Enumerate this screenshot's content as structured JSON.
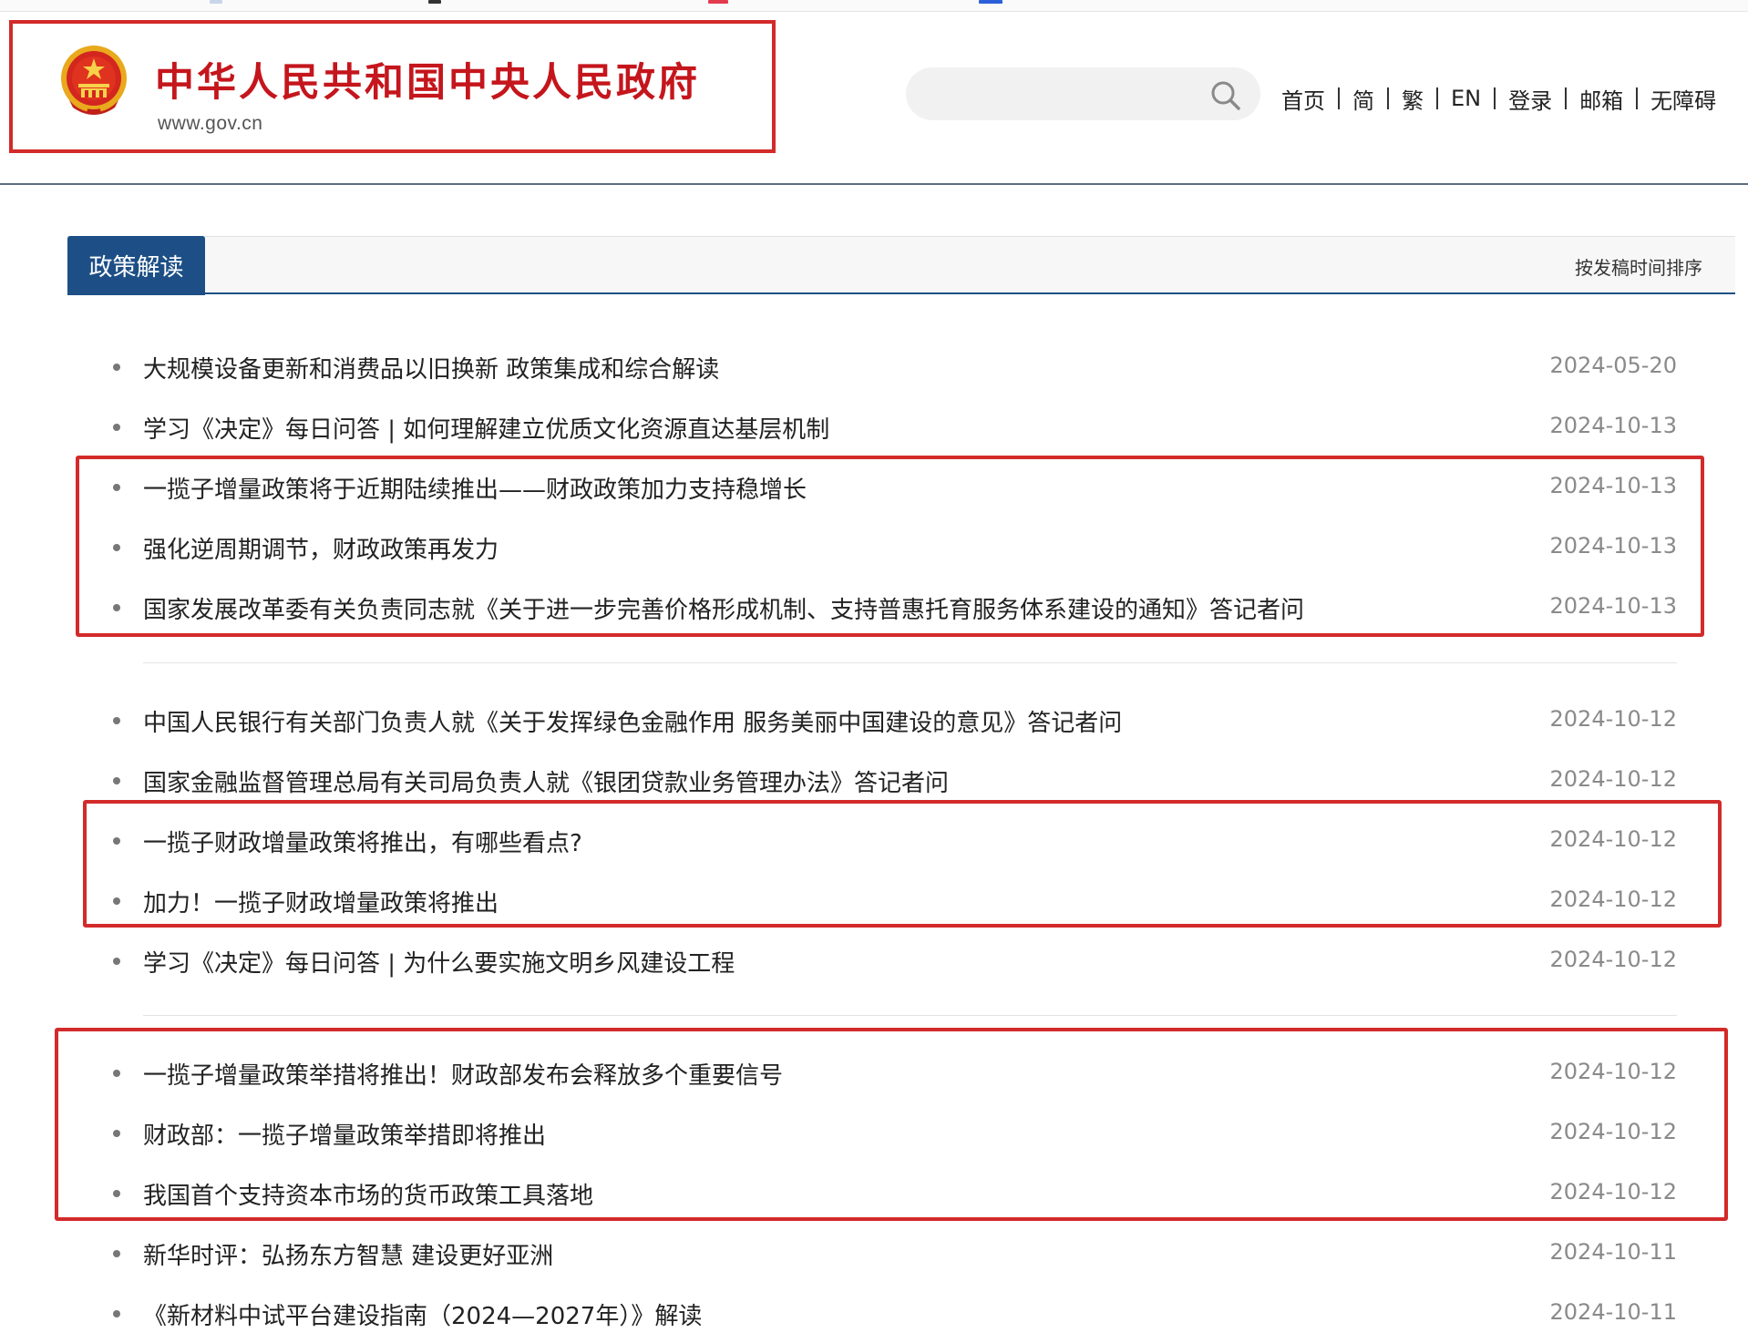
{
  "colors": {
    "accent_blue": "#1d4f86",
    "brand_red": "#c4161c",
    "highlight_red": "#d32a2a",
    "date_gray": "#8a8a8a"
  },
  "header": {
    "site_title": "中华人民共和国中央人民政府",
    "site_url": "www.gov.cn",
    "emblem_icon": "national-emblem-icon",
    "search": {
      "value": "",
      "placeholder": "",
      "icon": "search-icon"
    },
    "nav": [
      {
        "label": "首页"
      },
      {
        "label": "简"
      },
      {
        "label": "繁"
      },
      {
        "label": "EN"
      },
      {
        "label": "登录"
      },
      {
        "label": "邮箱"
      },
      {
        "label": "无障碍"
      }
    ]
  },
  "tabbar": {
    "active_tab": "政策解读",
    "sort_label": "按发稿时间排序"
  },
  "articles": [
    {
      "title": "大规模设备更新和消费品以旧换新 政策集成和综合解读",
      "date": "2024-05-20"
    },
    {
      "title": "学习《决定》每日问答 | 如何理解建立优质文化资源直达基层机制",
      "date": "2024-10-13"
    },
    {
      "title": "一揽子增量政策将于近期陆续推出——财政政策加力支持稳增长",
      "date": "2024-10-13"
    },
    {
      "title": "强化逆周期调节，财政政策再发力",
      "date": "2024-10-13"
    },
    {
      "title": "国家发展改革委有关负责同志就《关于进一步完善价格形成机制、支持普惠托育服务体系建设的通知》答记者问",
      "date": "2024-10-13"
    },
    {
      "title": "中国人民银行有关部门负责人就《关于发挥绿色金融作用 服务美丽中国建设的意见》答记者问",
      "date": "2024-10-12"
    },
    {
      "title": "国家金融监督管理总局有关司局负责人就《银团贷款业务管理办法》答记者问",
      "date": "2024-10-12"
    },
    {
      "title": "一揽子财政增量政策将推出，有哪些看点?",
      "date": "2024-10-12"
    },
    {
      "title": "加力！一揽子财政增量政策将推出",
      "date": "2024-10-12"
    },
    {
      "title": "学习《决定》每日问答 | 为什么要实施文明乡风建设工程",
      "date": "2024-10-12"
    },
    {
      "title": "一揽子增量政策举措将推出！财政部发布会释放多个重要信号",
      "date": "2024-10-12"
    },
    {
      "title": "财政部：一揽子增量政策举措即将推出",
      "date": "2024-10-12"
    },
    {
      "title": "我国首个支持资本市场的货币政策工具落地",
      "date": "2024-10-12"
    },
    {
      "title": "新华时评：弘扬东方智慧 建设更好亚洲",
      "date": "2024-10-11"
    },
    {
      "title": "《新材料中试平台建设指南（2024—2027年）》解读",
      "date": "2024-10-11"
    }
  ]
}
